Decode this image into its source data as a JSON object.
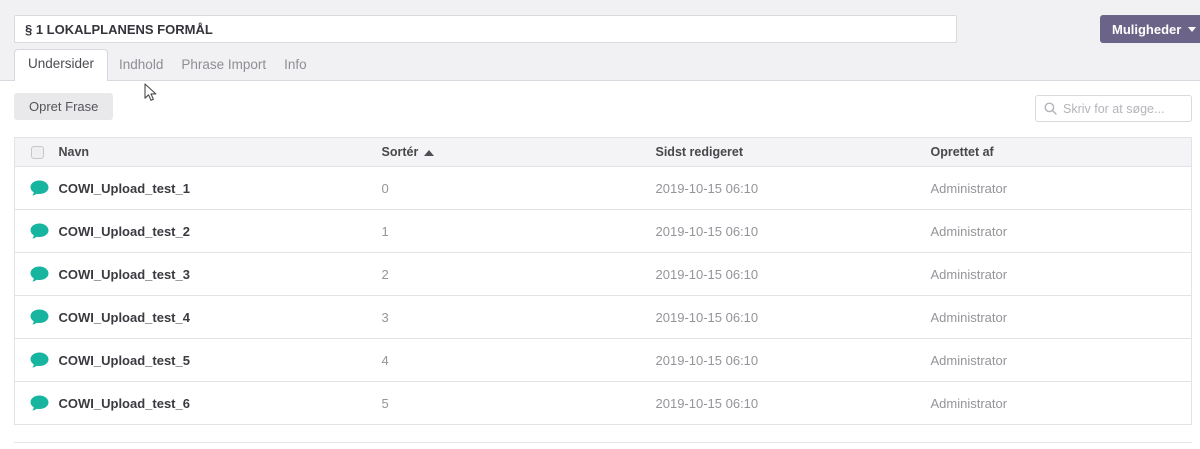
{
  "header": {
    "title_value": "§ 1 LOKALPLANENS FORMÅL",
    "options_button": "Muligheder"
  },
  "tabs": [
    {
      "label": "Undersider",
      "active": true
    },
    {
      "label": "Indhold",
      "active": false
    },
    {
      "label": "Phrase Import",
      "active": false
    },
    {
      "label": "Info",
      "active": false
    }
  ],
  "toolbar": {
    "create_button": "Opret Frase",
    "search_placeholder": "Skriv for at søge..."
  },
  "table": {
    "columns": {
      "name": "Navn",
      "sort": "Sortér",
      "sort_direction": "ascending",
      "last_edited": "Sidst redigeret",
      "created_by": "Oprettet af"
    },
    "rows": [
      {
        "name": "COWI_Upload_test_1",
        "sort": "0",
        "last_edited": "2019-10-15 06:10",
        "created_by": "Administrator"
      },
      {
        "name": "COWI_Upload_test_2",
        "sort": "1",
        "last_edited": "2019-10-15 06:10",
        "created_by": "Administrator"
      },
      {
        "name": "COWI_Upload_test_3",
        "sort": "2",
        "last_edited": "2019-10-15 06:10",
        "created_by": "Administrator"
      },
      {
        "name": "COWI_Upload_test_4",
        "sort": "3",
        "last_edited": "2019-10-15 06:10",
        "created_by": "Administrator"
      },
      {
        "name": "COWI_Upload_test_5",
        "sort": "4",
        "last_edited": "2019-10-15 06:10",
        "created_by": "Administrator"
      },
      {
        "name": "COWI_Upload_test_6",
        "sort": "5",
        "last_edited": "2019-10-15 06:10",
        "created_by": "Administrator"
      }
    ]
  },
  "colors": {
    "accent_purple": "#6c6488",
    "icon_teal": "#17b5a0",
    "header_band": "#f1f1f3"
  }
}
